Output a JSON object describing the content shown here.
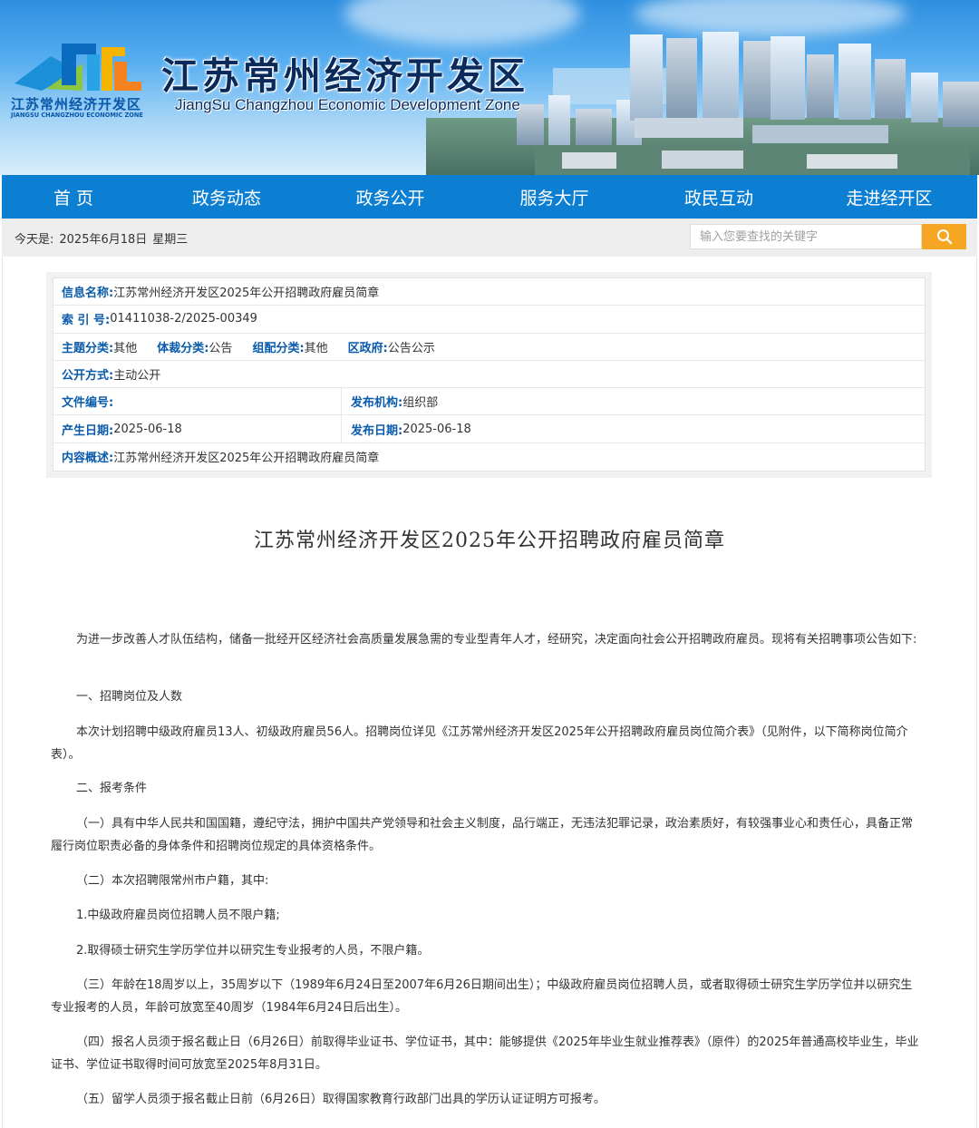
{
  "header": {
    "logo_text_cn": "江苏常州经济开发区",
    "logo_text_en": "JIANGSU CHANGZHOU ECONOMIC ZONE",
    "title": "江苏常州经济开发区",
    "subtitle": "JiangSu Changzhou Economic Development Zone"
  },
  "nav": {
    "items": [
      "首 页",
      "政务动态",
      "政务公开",
      "服务大厅",
      "政民互动",
      "走进经开区"
    ]
  },
  "infobar": {
    "today_label": "今天是:",
    "today_date": "2025年6月18日",
    "today_weekday": "星期三",
    "search_placeholder": "输入您要查找的关键字",
    "search_icon": "search-icon"
  },
  "meta": {
    "info_name_label": "信息名称:",
    "info_name": "江苏常州经济开发区2025年公开招聘政府雇员简章",
    "index_label": "索 引 号:",
    "index": "01411038-2/2025-00349",
    "topic_label": "主题分类:",
    "topic": "其他",
    "genre_label": "体裁分类:",
    "genre": "公告",
    "org_class_label": "组配分类:",
    "org_class": "其他",
    "district_label": "区政府:",
    "district": "公告公示",
    "open_mode_label": "公开方式:",
    "open_mode": "主动公开",
    "doc_no_label": "文件编号:",
    "doc_no": "",
    "publisher_label": "发布机构:",
    "publisher": "组织部",
    "created_label": "产生日期:",
    "created": "2025-06-18",
    "published_label": "发布日期:",
    "published": "2025-06-18",
    "summary_label": "内容概述:",
    "summary": "江苏常州经济开发区2025年公开招聘政府雇员简章"
  },
  "article": {
    "title": "江苏常州经济开发区2025年公开招聘政府雇员简章",
    "paragraphs": [
      "为进一步改善人才队伍结构，储备一批经开区经济社会高质量发展急需的专业型青年人才，经研究，决定面向社会公开招聘政府雇员。现将有关招聘事项公告如下:",
      "一、招聘岗位及人数",
      "本次计划招聘中级政府雇员13人、初级政府雇员56人。招聘岗位详见《江苏常州经济开发区2025年公开招聘政府雇员岗位简介表》（见附件，以下简称岗位简介表）。",
      "二、报考条件",
      "（一）具有中华人民共和国国籍，遵纪守法，拥护中国共产党领导和社会主义制度，品行端正，无违法犯罪记录，政治素质好，有较强事业心和责任心，具备正常履行岗位职责必备的身体条件和招聘岗位规定的具体资格条件。",
      "（二）本次招聘限常州市户籍，其中:",
      "1.中级政府雇员岗位招聘人员不限户籍;",
      "2.取得硕士研究生学历学位并以研究生专业报考的人员，不限户籍。",
      "（三）年龄在18周岁以上，35周岁以下（1989年6月24日至2007年6月26日期间出生）；中级政府雇员岗位招聘人员，或者取得硕士研究生学历学位并以研究生专业报考的人员，年龄可放宽至40周岁（1984年6月24日后出生）。",
      "（四）报名人员须于报名截止日（6月26日）前取得毕业证书、学位证书，其中：能够提供《2025年毕业生就业推荐表》（原件）的2025年普通高校毕业生，毕业证书、学位证书取得时间可放宽至2025年8月31日。",
      "（五）留学人员须于报名截止日前（6月26日）取得国家教育行政部门出具的学历认证证明方可报考。"
    ]
  },
  "colors": {
    "nav_bg": "#0c7fd3",
    "meta_label": "#0a5bab",
    "search_button": "#f5a623"
  }
}
